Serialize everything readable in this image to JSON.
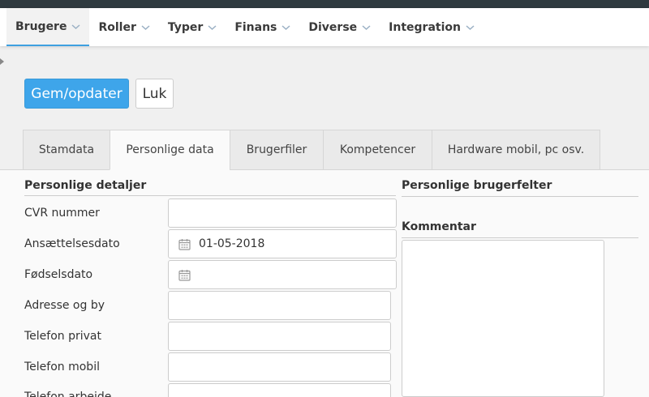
{
  "nav": {
    "items": [
      {
        "label": "Brugere"
      },
      {
        "label": "Roller"
      },
      {
        "label": "Typer"
      },
      {
        "label": "Finans"
      },
      {
        "label": "Diverse"
      },
      {
        "label": "Integration"
      }
    ]
  },
  "toolbar": {
    "save_label": "Gem/opdater",
    "close_label": "Luk"
  },
  "tabs": [
    {
      "label": "Stamdata"
    },
    {
      "label": "Personlige data"
    },
    {
      "label": "Brugerfiler"
    },
    {
      "label": "Kompetencer"
    },
    {
      "label": "Hardware mobil, pc osv."
    }
  ],
  "personal": {
    "title": "Personlige detaljer",
    "fields": [
      {
        "label": "CVR nummer",
        "value": ""
      },
      {
        "label": "Ansættelsesdato",
        "value": "01-05-2018"
      },
      {
        "label": "Fødselsdato",
        "value": ""
      },
      {
        "label": "Adresse og by",
        "value": ""
      },
      {
        "label": "Telefon privat",
        "value": ""
      },
      {
        "label": "Telefon mobil",
        "value": ""
      },
      {
        "label": "Telefon arbejde",
        "value": ""
      }
    ]
  },
  "user_fields": {
    "title": "Personlige brugerfelter"
  },
  "comment": {
    "title": "Kommentar",
    "value": ""
  },
  "colors": {
    "primary": "#3ea5ea",
    "topbar": "#2f3a3f",
    "active_tab_underline": "#3ea0e0"
  }
}
